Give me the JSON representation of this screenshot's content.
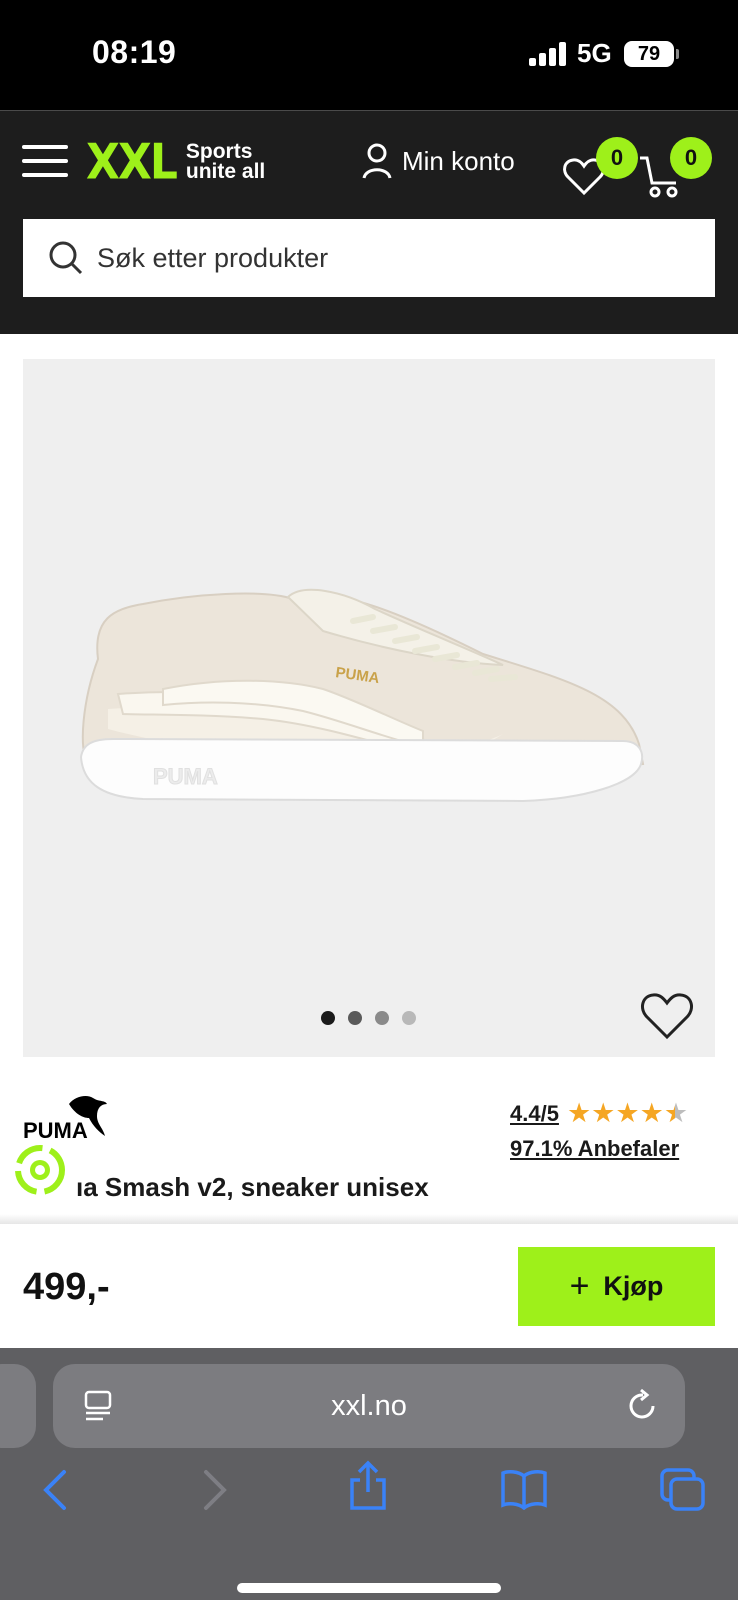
{
  "status_bar": {
    "time": "08:19",
    "network": "5G",
    "battery": "79"
  },
  "header": {
    "logo_mark": "XXL",
    "logo_tagline_line1": "Sports",
    "logo_tagline_line2": "unite all",
    "account_label": "Min konto",
    "wishlist_count": "0",
    "cart_count": "0",
    "search_placeholder": "Søk etter produkter"
  },
  "product": {
    "image_count": 4,
    "active_image_index": 0,
    "brand": "PUMA",
    "title": "ıa Smash v2, sneaker unisex",
    "rating_text": "4.4/5",
    "rating_value": 4.4,
    "rating_max": 5,
    "recommend_text": "97.1% Anbefaler",
    "price": "499,-",
    "buy_label": "Kjøp"
  },
  "browser": {
    "url": "xxl.no"
  },
  "colors": {
    "accent": "#9ef01a",
    "header_bg": "#1d1d1d",
    "gallery_bg": "#efefef",
    "star": "#f5a623",
    "browser_blue": "#3a82f7"
  }
}
